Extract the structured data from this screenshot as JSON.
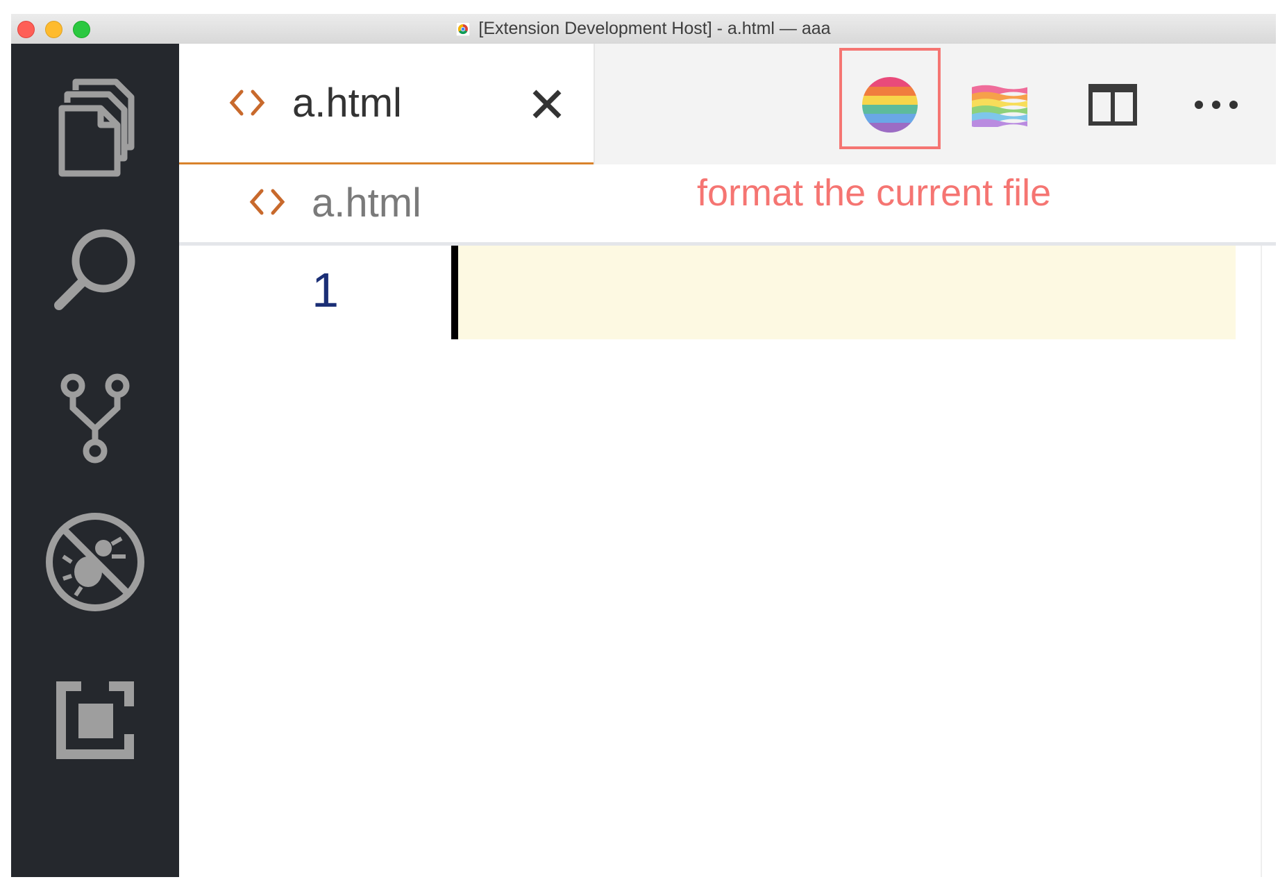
{
  "window": {
    "title": "[Extension Development Host] - a.html — aaa"
  },
  "activity_bar": {
    "icons": [
      "files-icon",
      "search-icon",
      "source-control-icon",
      "debug-disabled-icon",
      "extensions-icon"
    ]
  },
  "tabs": [
    {
      "label": "a.html",
      "icon": "html-file-icon",
      "active": true
    }
  ],
  "editor_actions": [
    {
      "icon": "rainbow-circle-icon",
      "highlighted": true
    },
    {
      "icon": "rainbow-flag-icon"
    },
    {
      "icon": "split-editor-icon"
    },
    {
      "icon": "more-actions-icon"
    }
  ],
  "breadcrumb": {
    "file": "a.html"
  },
  "annotation": {
    "text": "format the current file",
    "color": "#f57572"
  },
  "editor": {
    "line_numbers": [
      "1"
    ]
  },
  "colors": {
    "activity_bar": "#25282d",
    "tab_accent": "#d9822b",
    "current_line": "#fdf9e2"
  }
}
